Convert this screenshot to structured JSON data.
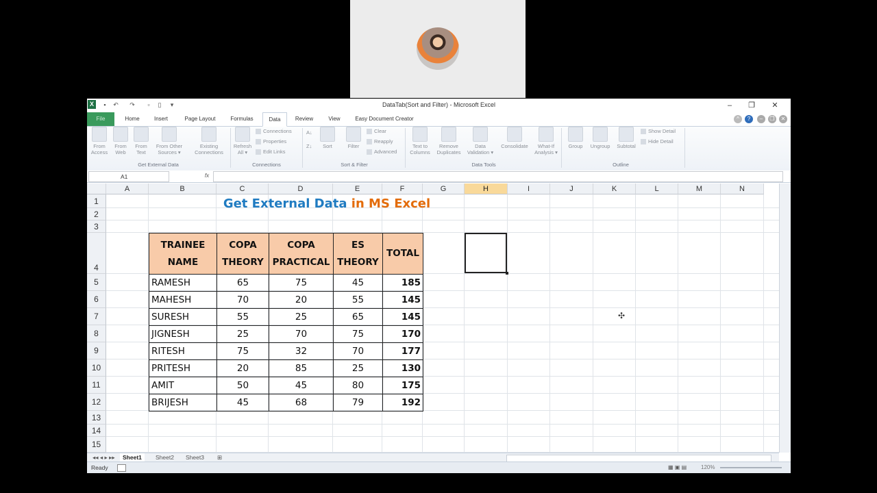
{
  "window": {
    "title": "DataTab(Sort and Filter)  -  Microsoft Excel",
    "controls": {
      "minimize": "–",
      "restore": "❐",
      "close": "✕"
    }
  },
  "tabs": [
    "File",
    "Home",
    "Insert",
    "Page Layout",
    "Formulas",
    "Data",
    "Review",
    "View",
    "Easy Document Creator"
  ],
  "active_tab": "Data",
  "ribbon": {
    "get_external": {
      "label": "Get External Data",
      "buttons": [
        [
          "From",
          "Access"
        ],
        [
          "From",
          "Web"
        ],
        [
          "From",
          "Text"
        ],
        [
          "From Other",
          "Sources ▾"
        ],
        [
          "Existing",
          "Connections"
        ]
      ]
    },
    "connections": {
      "label": "Connections",
      "refresh": [
        "Refresh",
        "All ▾"
      ],
      "small": [
        "Connections",
        "Properties",
        "Edit Links"
      ]
    },
    "sort_filter": {
      "label": "Sort & Filter",
      "sort": "Sort",
      "filter": "Filter",
      "small": [
        "Clear",
        "Reapply",
        "Advanced"
      ]
    },
    "data_tools": {
      "label": "Data Tools",
      "buttons": [
        [
          "Text to",
          "Columns"
        ],
        [
          "Remove",
          "Duplicates"
        ],
        [
          "Data",
          "Validation ▾"
        ],
        [
          "Consolidate",
          ""
        ],
        [
          "What-If",
          "Analysis ▾"
        ]
      ]
    },
    "outline": {
      "label": "Outline",
      "buttons": [
        [
          "Group",
          ""
        ],
        [
          "Ungroup",
          ""
        ],
        [
          "Subtotal",
          ""
        ]
      ],
      "small": [
        "Show Detail",
        "Hide Detail"
      ]
    }
  },
  "formula_bar": {
    "name_box": "A1",
    "fx": "fx",
    "value": ""
  },
  "columns": [
    "A",
    "B",
    "C",
    "D",
    "E",
    "F",
    "G",
    "H",
    "I",
    "J",
    "K",
    "L",
    "M",
    "N"
  ],
  "selected_column": "H",
  "rows": [
    "1",
    "2",
    "3",
    "4",
    "5",
    "6",
    "7",
    "8",
    "9",
    "10",
    "11",
    "12",
    "13",
    "14",
    "15"
  ],
  "sheet_title": {
    "part1": "Get External Data",
    "part2": "in MS Excel",
    "color1": "#1f7bc1",
    "color2": "#e36c0a"
  },
  "table": {
    "header_fill": "#f8cba9",
    "headers": [
      [
        "TRAINEE",
        "NAME"
      ],
      [
        "COPA",
        "THEORY"
      ],
      [
        "COPA",
        "PRACTICAL"
      ],
      [
        "ES",
        "THEORY"
      ],
      [
        "TOTAL",
        ""
      ]
    ],
    "rows": [
      [
        "RAMESH",
        "65",
        "75",
        "45",
        "185"
      ],
      [
        "MAHESH",
        "70",
        "20",
        "55",
        "145"
      ],
      [
        "SURESH",
        "55",
        "25",
        "65",
        "145"
      ],
      [
        "JIGNESH",
        "25",
        "70",
        "75",
        "170"
      ],
      [
        "RITESH",
        "75",
        "32",
        "70",
        "177"
      ],
      [
        "PRITESH",
        "20",
        "85",
        "25",
        "130"
      ],
      [
        "AMIT",
        "50",
        "45",
        "80",
        "175"
      ],
      [
        "BRIJESH",
        "45",
        "68",
        "79",
        "192"
      ]
    ]
  },
  "sheets": [
    "Sheet1",
    "Sheet2",
    "Sheet3"
  ],
  "active_sheet": "Sheet1",
  "status": {
    "ready": "Ready",
    "zoom": "120%"
  }
}
